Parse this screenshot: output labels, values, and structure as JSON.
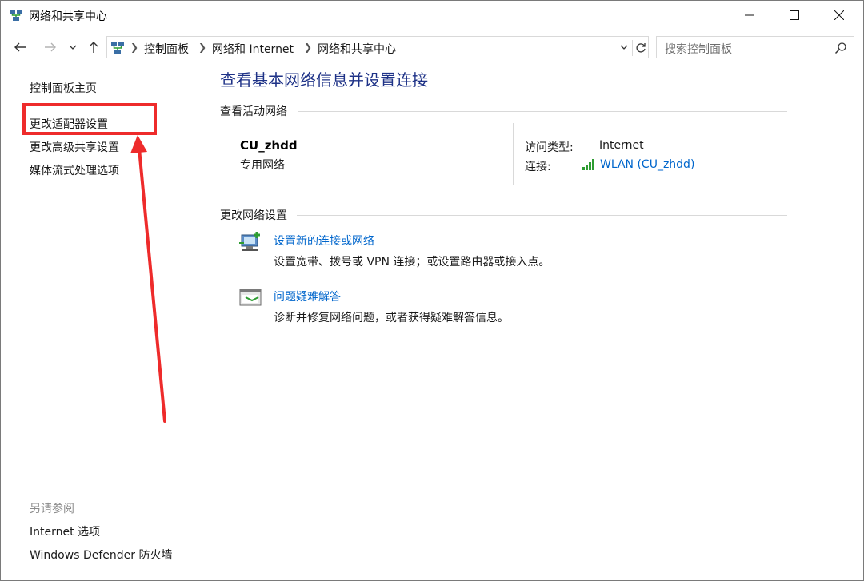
{
  "window": {
    "title": "网络和共享中心",
    "controls": {
      "minimize": "minimize",
      "maximize": "maximize",
      "close": "close"
    }
  },
  "address_bar": {
    "breadcrumbs": [
      "控制面板",
      "网络和 Internet",
      "网络和共享中心"
    ],
    "search_placeholder": "搜索控制面板"
  },
  "sidebar": {
    "home": "控制面板主页",
    "items": [
      "更改适配器设置",
      "更改高级共享设置",
      "媒体流式处理选项"
    ],
    "see_also_heading": "另请参阅",
    "see_also": [
      "Internet 选项",
      "Windows Defender 防火墙"
    ]
  },
  "main": {
    "title": "查看基本网络信息并设置连接",
    "active_networks_heading": "查看活动网络",
    "network": {
      "name": "CU_zhdd",
      "category": "专用网络",
      "access_type_label": "访问类型:",
      "access_type_value": "Internet",
      "connections_label": "连接:",
      "connection_link": "WLAN (CU_zhdd)"
    },
    "change_settings_heading": "更改网络设置",
    "tasks": [
      {
        "title": "设置新的连接或网络",
        "desc": "设置宽带、拨号或 VPN 连接；或设置路由器或接入点。",
        "icon": "network-setup-icon"
      },
      {
        "title": "问题疑难解答",
        "desc": "诊断并修复网络问题，或者获得疑难解答信息。",
        "icon": "troubleshoot-icon"
      }
    ]
  },
  "annotation": {
    "color": "#ee2b2b",
    "target": "更改适配器设置"
  },
  "colors": {
    "title_blue": "#1e3287",
    "link_blue": "#0066cc",
    "signal_green": "#2e9d32"
  }
}
